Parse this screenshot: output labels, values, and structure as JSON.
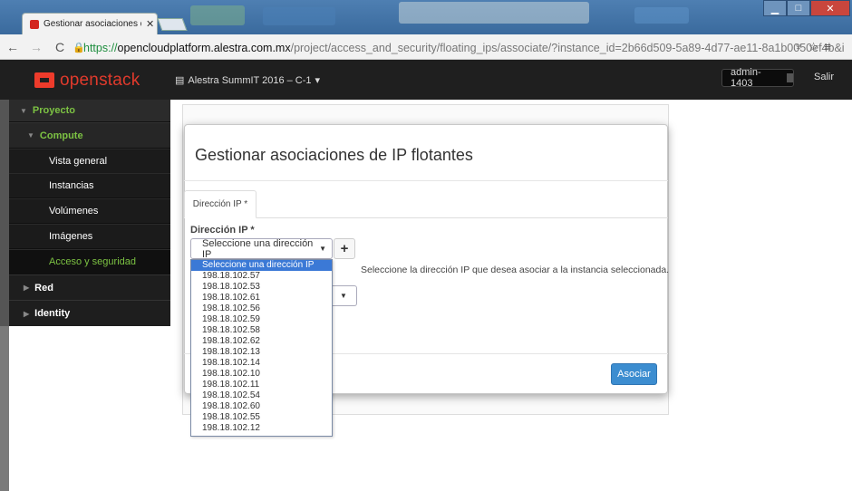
{
  "browser": {
    "tab_title": "Gestionar asociaciones de",
    "tab_close": "✕",
    "url_scheme": "https://",
    "url_host": "opencloudplatform.alestra.com.mx",
    "url_path": "/project/access_and_security/floating_ips/associate/?instance_id=2b66d509-5a89-4d77-ae11-8a1b0050ef4b&i",
    "win_min": "▁",
    "win_max": "□",
    "win_close": "✕"
  },
  "header": {
    "logo": "openstack",
    "project_selector": "Alestra SummIT 2016 – C-1",
    "project_caret": "▾",
    "user": "admin-1403",
    "logout": "Salir"
  },
  "sidebar": {
    "project": "Proyecto",
    "compute": "Compute",
    "items": [
      "Vista general",
      "Instancias",
      "Volúmenes",
      "Imágenes",
      "Acceso y seguridad"
    ],
    "red": "Red",
    "identity": "Identity"
  },
  "modal": {
    "title": "Gestionar asociaciones de IP flotantes",
    "tab": "Dirección IP *",
    "field_label": "Dirección IP *",
    "select_value": "Seleccione una dirección IP",
    "add_symbol": "+",
    "help": "Seleccione la dirección IP que desea asociar a la instancia seleccionada.",
    "submit": "Asociar"
  },
  "dropdown": {
    "options": [
      "Seleccione una dirección IP",
      "198.18.102.57",
      "198.18.102.53",
      "198.18.102.61",
      "198.18.102.56",
      "198.18.102.59",
      "198.18.102.58",
      "198.18.102.62",
      "198.18.102.13",
      "198.18.102.14",
      "198.18.102.10",
      "198.18.102.11",
      "198.18.102.54",
      "198.18.102.60",
      "198.18.102.55",
      "198.18.102.12"
    ],
    "selected_index": 0
  },
  "colors": {
    "accent_green": "#7cc243",
    "brand_red": "#e03a2c",
    "primary_blue": "#3c8dd0"
  }
}
